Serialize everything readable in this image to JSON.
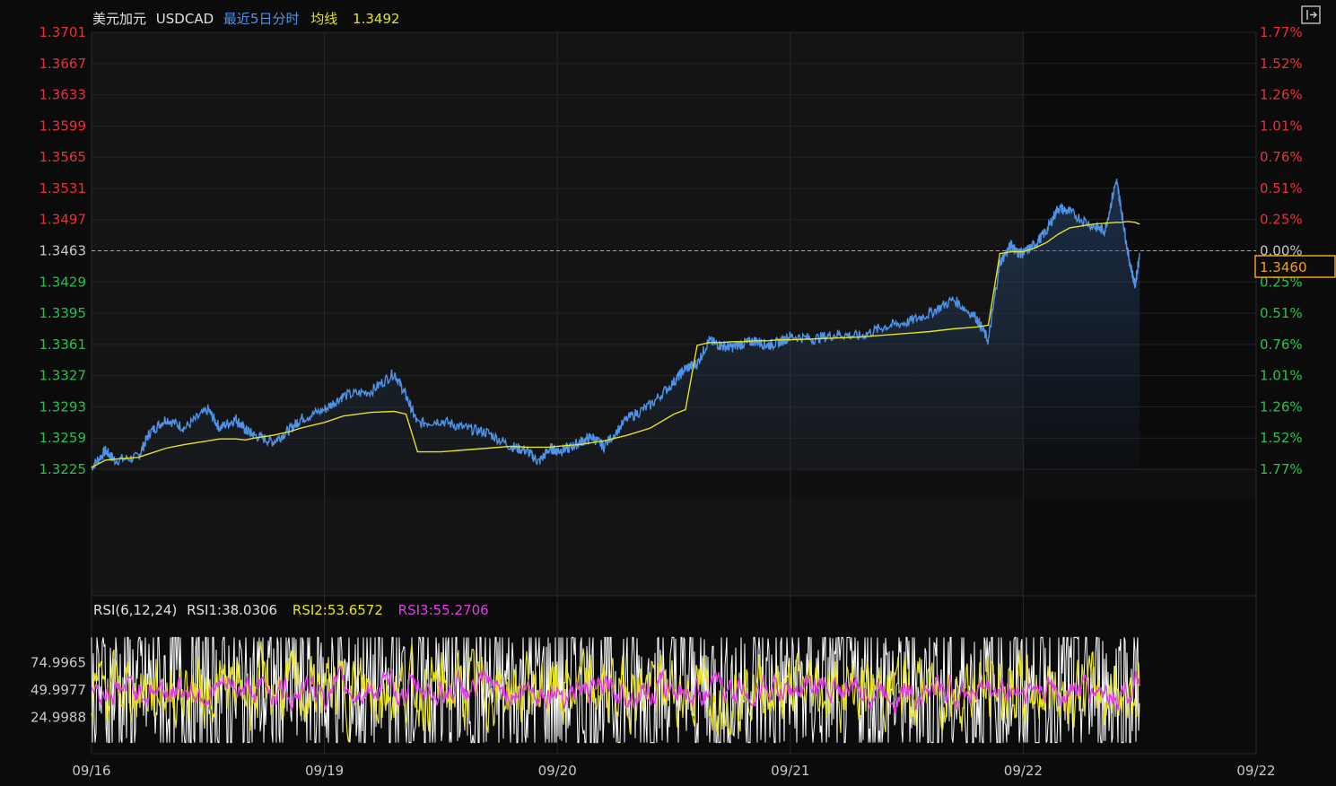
{
  "header": {
    "name": "美元加元",
    "symbol": "USDCAD",
    "period": "最近5日分时",
    "ma_label": "均线",
    "ma_value": "1.3492"
  },
  "rsi_header": {
    "label": "RSI(6,12,24)",
    "rsi1": "RSI1:38.0306",
    "rsi2": "RSI2:53.6572",
    "rsi3": "RSI3:55.2706"
  },
  "colors": {
    "background": "#0b0b0b",
    "panel": "#141414",
    "price_line": "#4f93e8",
    "ma_line": "#e6e21f",
    "up_red": "#e8303a",
    "down_green": "#27c24c",
    "reference": "#f0a020",
    "rsi1": "#ffffff",
    "rsi2": "#e6e21f",
    "rsi3": "#e23ee8",
    "axis_text": "#c8c8c8"
  },
  "chart_data": [
    {
      "type": "line",
      "reference_price": 1.3463,
      "current_price_label": "1.3460",
      "y_ticks_price": [
        "1.3701",
        "1.3667",
        "1.3633",
        "1.3599",
        "1.3565",
        "1.3531",
        "1.3497",
        "1.3463",
        "1.3429",
        "1.3395",
        "1.3361",
        "1.3327",
        "1.3293",
        "1.3259",
        "1.3225"
      ],
      "y_ticks_pct": [
        "1.77%",
        "1.52%",
        "1.26%",
        "1.01%",
        "0.76%",
        "0.51%",
        "0.25%",
        "0.00%",
        "0.25%",
        "0.51%",
        "0.76%",
        "1.01%",
        "1.26%",
        "1.52%",
        "1.77%"
      ],
      "ylim": [
        1.3225,
        1.3701
      ],
      "x_tick_labels": [
        "09/16",
        "09/19",
        "09/20",
        "09/21",
        "09/22",
        "09/22"
      ],
      "x": [
        0,
        0.06,
        0.1,
        0.2,
        0.25,
        0.32,
        0.4,
        0.5,
        0.55,
        0.62,
        0.66,
        0.7,
        0.78,
        0.85,
        0.9,
        1,
        1.08,
        1.2,
        1.3,
        1.35,
        1.4,
        1.5,
        1.6,
        1.7,
        1.8,
        1.87,
        1.92,
        1.97,
        2,
        2.05,
        2.1,
        2.15,
        2.2,
        2.3,
        2.4,
        2.5,
        2.55,
        2.6,
        2.65,
        2.7,
        2.75,
        2.8,
        2.85,
        2.9,
        2.95,
        3,
        3.1,
        3.2,
        3.3,
        3.4,
        3.5,
        3.6,
        3.7,
        3.8,
        3.85,
        3.9,
        3.95,
        3.97,
        4,
        4.05,
        4.1,
        4.15,
        4.2,
        4.3,
        4.35,
        4.4,
        4.42,
        4.45,
        4.48,
        4.5
      ],
      "series": [
        {
          "values": [
            1.3227,
            1.3245,
            1.3235,
            1.3238,
            1.3265,
            1.328,
            1.327,
            1.329,
            1.327,
            1.328,
            1.3268,
            1.3262,
            1.3255,
            1.3268,
            1.328,
            1.329,
            1.3305,
            1.331,
            1.333,
            1.3305,
            1.3275,
            1.3278,
            1.327,
            1.3265,
            1.325,
            1.3245,
            1.3233,
            1.3248,
            1.3245,
            1.3248,
            1.3255,
            1.326,
            1.325,
            1.328,
            1.3295,
            1.332,
            1.3335,
            1.334,
            1.3365,
            1.336,
            1.3358,
            1.3362,
            1.3365,
            1.336,
            1.3363,
            1.337,
            1.3367,
            1.3372,
            1.337,
            1.338,
            1.3385,
            1.3395,
            1.341,
            1.339,
            1.3365,
            1.345,
            1.347,
            1.3462,
            1.346,
            1.347,
            1.3485,
            1.351,
            1.3505,
            1.349,
            1.3485,
            1.354,
            1.351,
            1.346,
            1.3425,
            1.346
          ]
        },
        {
          "values": [
            1.3227,
            1.3235,
            1.3236,
            1.3238,
            1.3242,
            1.3248,
            1.3252,
            1.3256,
            1.3258,
            1.3258,
            1.3257,
            1.3259,
            1.3262,
            1.3266,
            1.327,
            1.3276,
            1.3283,
            1.3287,
            1.3288,
            1.3285,
            1.3244,
            1.3244,
            1.3246,
            1.3248,
            1.325,
            1.3249,
            1.3249,
            1.3249,
            1.325,
            1.3251,
            1.3252,
            1.3254,
            1.3256,
            1.3262,
            1.327,
            1.3285,
            1.329,
            1.336,
            1.3363,
            1.3363,
            1.3364,
            1.3364,
            1.3365,
            1.3365,
            1.3366,
            1.3366,
            1.3367,
            1.3368,
            1.3369,
            1.3371,
            1.3373,
            1.3375,
            1.3378,
            1.338,
            1.3382,
            1.346,
            1.3462,
            1.3462,
            1.3462,
            1.3466,
            1.3472,
            1.3481,
            1.3488,
            1.3492,
            1.3493,
            1.3494,
            1.3494,
            1.3495,
            1.3494,
            1.3492
          ]
        }
      ]
    },
    {
      "type": "line",
      "y_ticks": [
        "74.9965",
        "49.9977",
        "24.9988"
      ],
      "ylim": [
        0,
        100
      ],
      "series": [
        {
          "name": "RSI1",
          "last": 38.0306
        },
        {
          "name": "RSI2",
          "last": 53.6572
        },
        {
          "name": "RSI3",
          "last": 55.2706
        }
      ]
    }
  ]
}
